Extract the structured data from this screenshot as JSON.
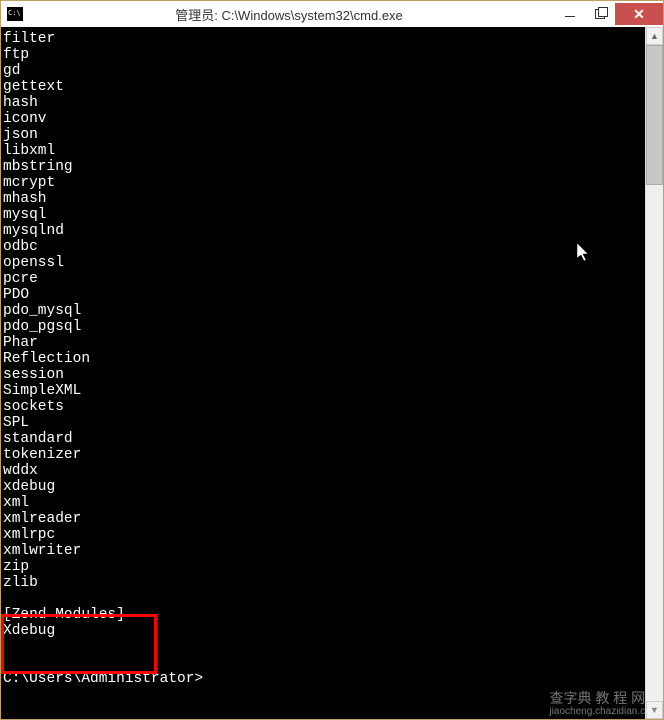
{
  "window": {
    "title": "管理员: C:\\Windows\\system32\\cmd.exe",
    "controls": {
      "minimize": "–",
      "maximize": "❐",
      "close": "✕"
    }
  },
  "modules": [
    "filter",
    "ftp",
    "gd",
    "gettext",
    "hash",
    "iconv",
    "json",
    "libxml",
    "mbstring",
    "mcrypt",
    "mhash",
    "mysql",
    "mysqlnd",
    "odbc",
    "openssl",
    "pcre",
    "PDO",
    "pdo_mysql",
    "pdo_pgsql",
    "Phar",
    "Reflection",
    "session",
    "SimpleXML",
    "sockets",
    "SPL",
    "standard",
    "tokenizer",
    "wddx",
    "xdebug",
    "xml",
    "xmlreader",
    "xmlrpc",
    "xmlwriter",
    "zip",
    "zlib"
  ],
  "zend_header": "[Zend Modules]",
  "zend_modules": [
    "Xdebug"
  ],
  "prompt": "C:\\Users\\Administrator>",
  "watermark": {
    "main": "查字典  教 程 网",
    "sub": "jiaocheng.chazidian.com"
  }
}
